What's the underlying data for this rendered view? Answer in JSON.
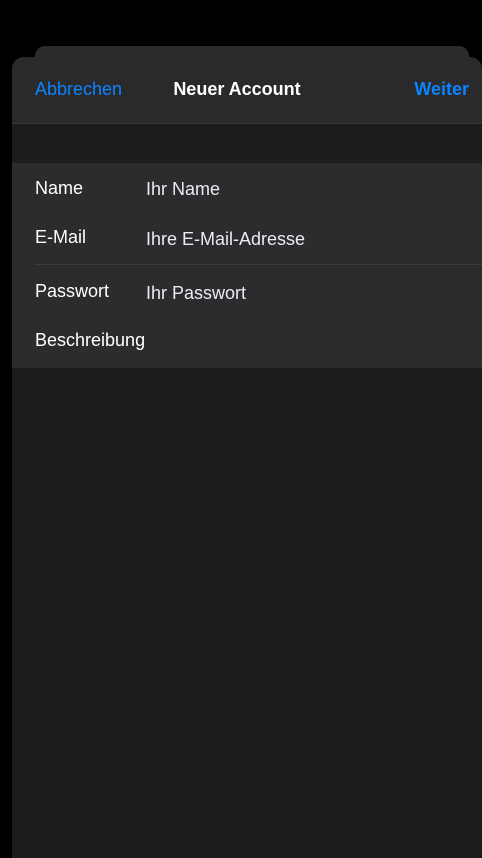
{
  "nav": {
    "cancel_label": "Abbrechen",
    "title": "Neuer Account",
    "next_label": "Weiter"
  },
  "form": {
    "rows": [
      {
        "label": "Name",
        "placeholder": "Ihr Name",
        "value": ""
      },
      {
        "label": "E-Mail",
        "placeholder": "Ihre E-Mail-Adresse",
        "value": ""
      },
      {
        "label": "Passwort",
        "placeholder": "Ihr Passwort",
        "value": ""
      },
      {
        "label": "Beschreibung",
        "placeholder": "",
        "value": ""
      }
    ]
  },
  "colors": {
    "accent": "#0a84ff",
    "background": "#000000",
    "sheet": "#1c1c1e",
    "group": "#2c2c2e"
  }
}
